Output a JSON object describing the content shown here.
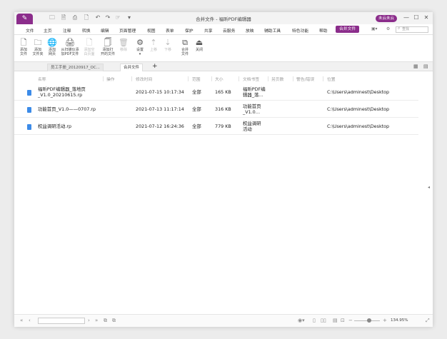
{
  "titlebar": {
    "title": "合并文件 - 福昕PDF编辑器",
    "user_button": "未云未云",
    "logo": "✎"
  },
  "menu": {
    "items": [
      "文件",
      "主页",
      "注释",
      "转换",
      "编辑",
      "页面管理",
      "视图",
      "表单",
      "保护",
      "共享",
      "云服务",
      "放映",
      "辅助工具",
      "特色功能",
      "帮助",
      "合并文件"
    ],
    "active": "合并文件",
    "search_placeholder": "查找"
  },
  "toolbar": {
    "tools": [
      {
        "icon": "add-file-icon",
        "glyph": "🗋",
        "label": "添加\n文件",
        "disabled": false
      },
      {
        "icon": "add-folder-icon",
        "glyph": "🗀",
        "label": "添加\n文件夹",
        "disabled": false
      },
      {
        "icon": "add-webpage-icon",
        "glyph": "🌐",
        "label": "添加\n网页",
        "disabled": false
      },
      {
        "icon": "scanner-icon",
        "glyph": "🖨",
        "label": "从扫描仪添\n加PDF文件",
        "disabled": false
      },
      {
        "icon": "add-blank-icon",
        "glyph": "🗋",
        "label": "添加空\n白页面",
        "disabled": true
      },
      {
        "icon": "add-open-icon",
        "glyph": "🗍",
        "label": "添加打\n开的文件",
        "disabled": false
      },
      {
        "icon": "remove-icon",
        "glyph": "🗑",
        "label": "移除",
        "disabled": true
      },
      {
        "icon": "settings-icon",
        "glyph": "⚙",
        "label": "设置\n▾",
        "disabled": false
      },
      {
        "icon": "move-up-icon",
        "glyph": "⇡",
        "label": "上移",
        "disabled": true
      },
      {
        "icon": "move-down-icon",
        "glyph": "⇣",
        "label": "下移",
        "disabled": true
      },
      {
        "icon": "merge-icon",
        "glyph": "⧉",
        "label": "合并\n文件",
        "disabled": false
      },
      {
        "icon": "close-icon",
        "glyph": "⏏",
        "label": "关闭",
        "disabled": false
      }
    ]
  },
  "tabs": [
    {
      "label": "员工手册_20120917_OC...",
      "active": false
    },
    {
      "label": "合并文件",
      "active": true
    }
  ],
  "table": {
    "headers": [
      "名称",
      "操作",
      "修改时间",
      "范围",
      "大小",
      "文档书签",
      "另页数",
      "警告/错误",
      "位置"
    ],
    "rows": [
      {
        "name": "福昕PDF编辑器_落地页\n_V1.0_20210615.rp",
        "modified": "2021-07-15 10:17:34",
        "range": "全部",
        "size": "165 KB",
        "bookmark": "福昕PDF编\n辑器_落…",
        "location": "C:\\Users\\adminest\\Desktop"
      },
      {
        "name": "功能首页_V1.0——0707.rp",
        "modified": "2021-07-13 11:17:14",
        "range": "全部",
        "size": "316 KB",
        "bookmark": "功能首页\n_V1.0…",
        "location": "C:\\Users\\adminest\\Desktop"
      },
      {
        "name": "权益调研活动.rp",
        "modified": "2021-07-12 16:24:36",
        "range": "全部",
        "size": "779 KB",
        "bookmark": "权益调研\n活动",
        "location": "C:\\Users\\adminest\\Desktop"
      }
    ]
  },
  "statusbar": {
    "zoom": "134.95%"
  },
  "colors": {
    "accent": "#8b2d8b",
    "file_icon": "#3c8be8"
  }
}
